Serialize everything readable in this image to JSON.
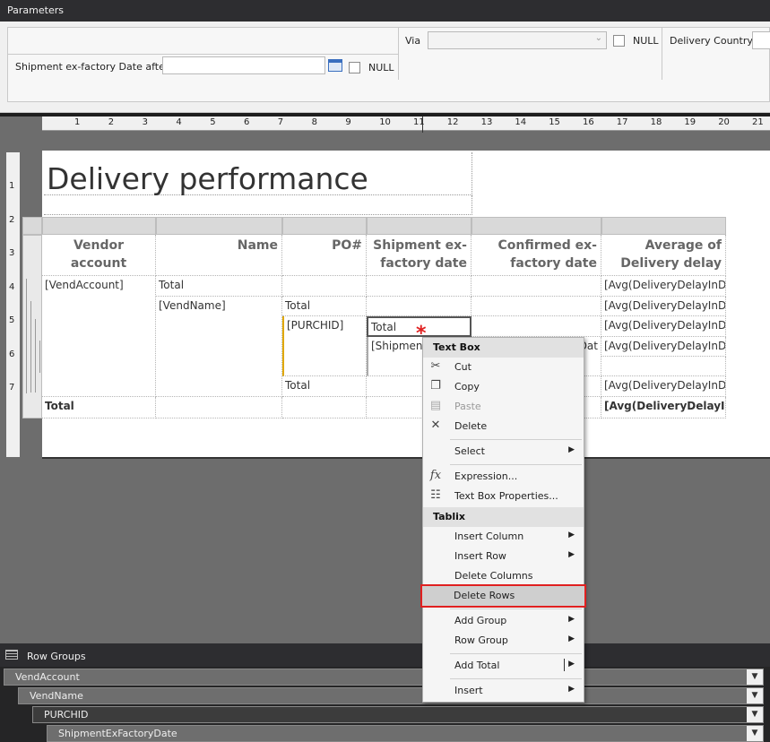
{
  "parameters": {
    "panel_title": "Parameters",
    "via_label": "Via",
    "via_value": "",
    "null_label_1": "NULL",
    "delivery_country_label": "Delivery Country",
    "shipment_date_label": "Shipment ex-factory Date after",
    "shipment_date_value": "",
    "null_label_2": "NULL"
  },
  "ruler": {
    "top_ticks": [
      "1",
      "2",
      "3",
      "4",
      "5",
      "6",
      "7",
      "8",
      "9",
      "10",
      "11",
      "12",
      "13",
      "14",
      "15",
      "16",
      "17",
      "18",
      "19",
      "20",
      "21"
    ],
    "left_ticks": [
      "1",
      "2",
      "3",
      "4",
      "5",
      "6",
      "7"
    ]
  },
  "report": {
    "title": "Delivery performance",
    "headers": [
      "Vendor account",
      "Name",
      "PO#",
      "Shipment ex-factory date",
      "Confirmed ex-factory date",
      "Average of Delivery delay (-)"
    ],
    "row1": {
      "c1": "[VendAccount]",
      "c2": "Total",
      "c6": "[Avg(DeliveryDelayInDa"
    },
    "row2": {
      "c2": "[VendName]",
      "c3": "Total",
      "c6": "[Avg(DeliveryDelayInDa"
    },
    "row3": {
      "c3": "[PURCHID]",
      "c4": "Total",
      "c6": "[Avg(DeliveryDelayInDa"
    },
    "row4": {
      "c4": "[Shipment",
      "c5": "Dat",
      "c6": "[Avg(DeliveryDelayInDa"
    },
    "row5": {
      "c3": "Total",
      "c6": "[Avg(DeliveryDelayInDa"
    },
    "row6": {
      "c1": "Total",
      "c6": "[Avg(DeliveryDelayIn"
    }
  },
  "context_menu": {
    "header_textbox": "Text Box",
    "cut": "Cut",
    "copy": "Copy",
    "paste": "Paste",
    "delete": "Delete",
    "select": "Select",
    "expression": "Expression...",
    "textbox_properties": "Text Box Properties...",
    "header_tablix": "Tablix",
    "insert_column": "Insert Column",
    "insert_row": "Insert Row",
    "delete_columns": "Delete Columns",
    "delete_rows": "Delete Rows",
    "add_group": "Add Group",
    "row_group": "Row Group",
    "add_total": "Add Total",
    "insert": "Insert"
  },
  "row_groups": {
    "title": "Row Groups",
    "items": [
      "VendAccount",
      "VendName",
      "PURCHID",
      "ShipmentExFactoryDate"
    ]
  },
  "colors": {
    "highlight_border": "#e02020",
    "selection_yellow": "#e0a800",
    "marker_red": "#e02020"
  }
}
